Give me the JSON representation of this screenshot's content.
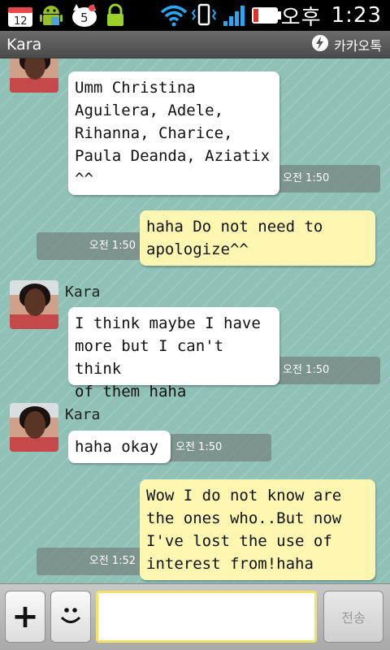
{
  "status_bar": {
    "calendar_date": "12",
    "notification_count": "5",
    "ampm": "오후",
    "time": "1:23"
  },
  "header": {
    "title": "Kara",
    "brand": "카카오톡"
  },
  "messages": [
    {
      "direction": "incoming",
      "text": "Umm Christina\nAguilera, Adele,\nRihanna, Charice,\nPaula Deanda, Aziatix\n^^",
      "time": "오전 1:50"
    },
    {
      "direction": "outgoing",
      "text": "haha Do not need to\napologize^^",
      "time": "오전 1:50"
    },
    {
      "direction": "incoming",
      "sender": "Kara",
      "text": "I think maybe I have\nmore but I can't think\nof them haha",
      "time": "오전 1:50"
    },
    {
      "direction": "incoming",
      "sender": "Kara",
      "text": "haha okay",
      "time": "오전 1:50"
    },
    {
      "direction": "outgoing",
      "text": "Wow I do not know are\nthe ones who..But now\nI've lost the use of\ninterest from!haha",
      "time": "오전 1:52"
    }
  ],
  "input_bar": {
    "add_label": "+",
    "message_value": "",
    "send_label": "전송"
  },
  "colors": {
    "chat_background": "#8fc1b7",
    "outgoing_bubble": "#fdf6b1",
    "incoming_bubble": "#ffffff",
    "input_border": "#f1e36a"
  },
  "icons": [
    "calendar-icon",
    "android-icon",
    "hello-kitty-icon",
    "lock-icon",
    "wifi-icon",
    "vibrate-icon",
    "signal-icon",
    "battery-icon",
    "kakaotalk-icon",
    "emoticon-icon"
  ]
}
